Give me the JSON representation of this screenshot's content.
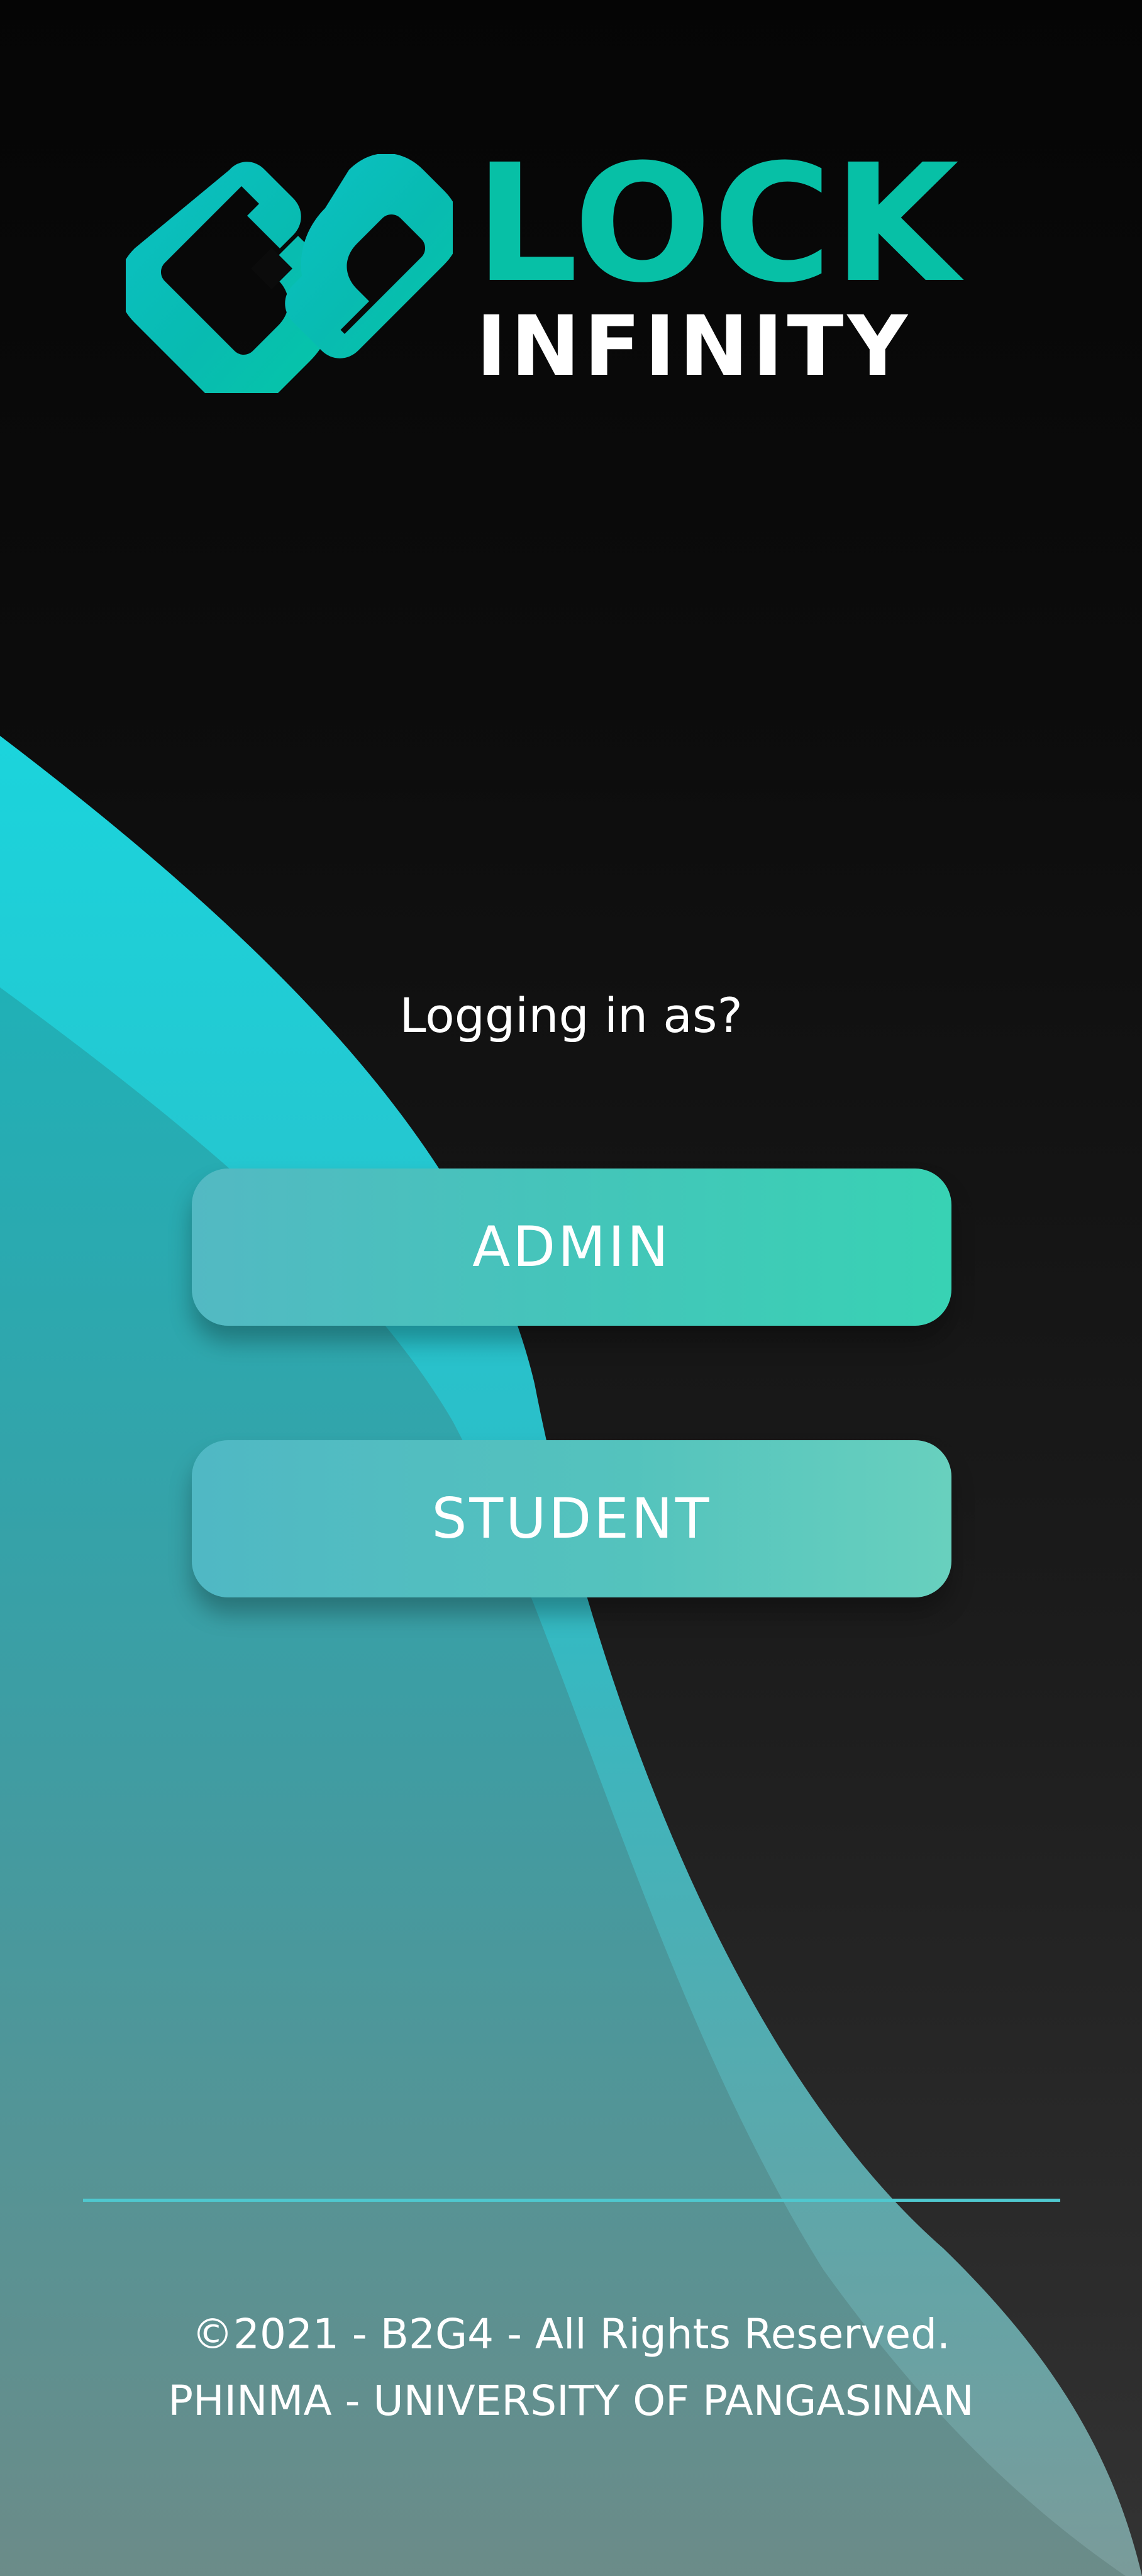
{
  "brand": {
    "name_primary": "LOCK",
    "name_secondary": "INFINITY",
    "icon": "lock-infinity-logo-icon"
  },
  "login": {
    "prompt": "Logging in as?",
    "admin_label": "ADMIN",
    "student_label": "STUDENT"
  },
  "footer": {
    "copyright": "©2021 - B2G4 - All Rights Reserved.",
    "institution": "PHINMA - UNIVERSITY OF PANGASINAN"
  },
  "colors": {
    "background_top": "#050505",
    "background_bottom": "#333333",
    "brand_teal": "#07C0A6",
    "wave_light": "#18D0D8",
    "wave_dark": "#36A5A5",
    "button_start": "#53B9C3",
    "button_end": "#38D2B4",
    "divider": "#4FC8CF",
    "text": "#FFFFFF"
  }
}
